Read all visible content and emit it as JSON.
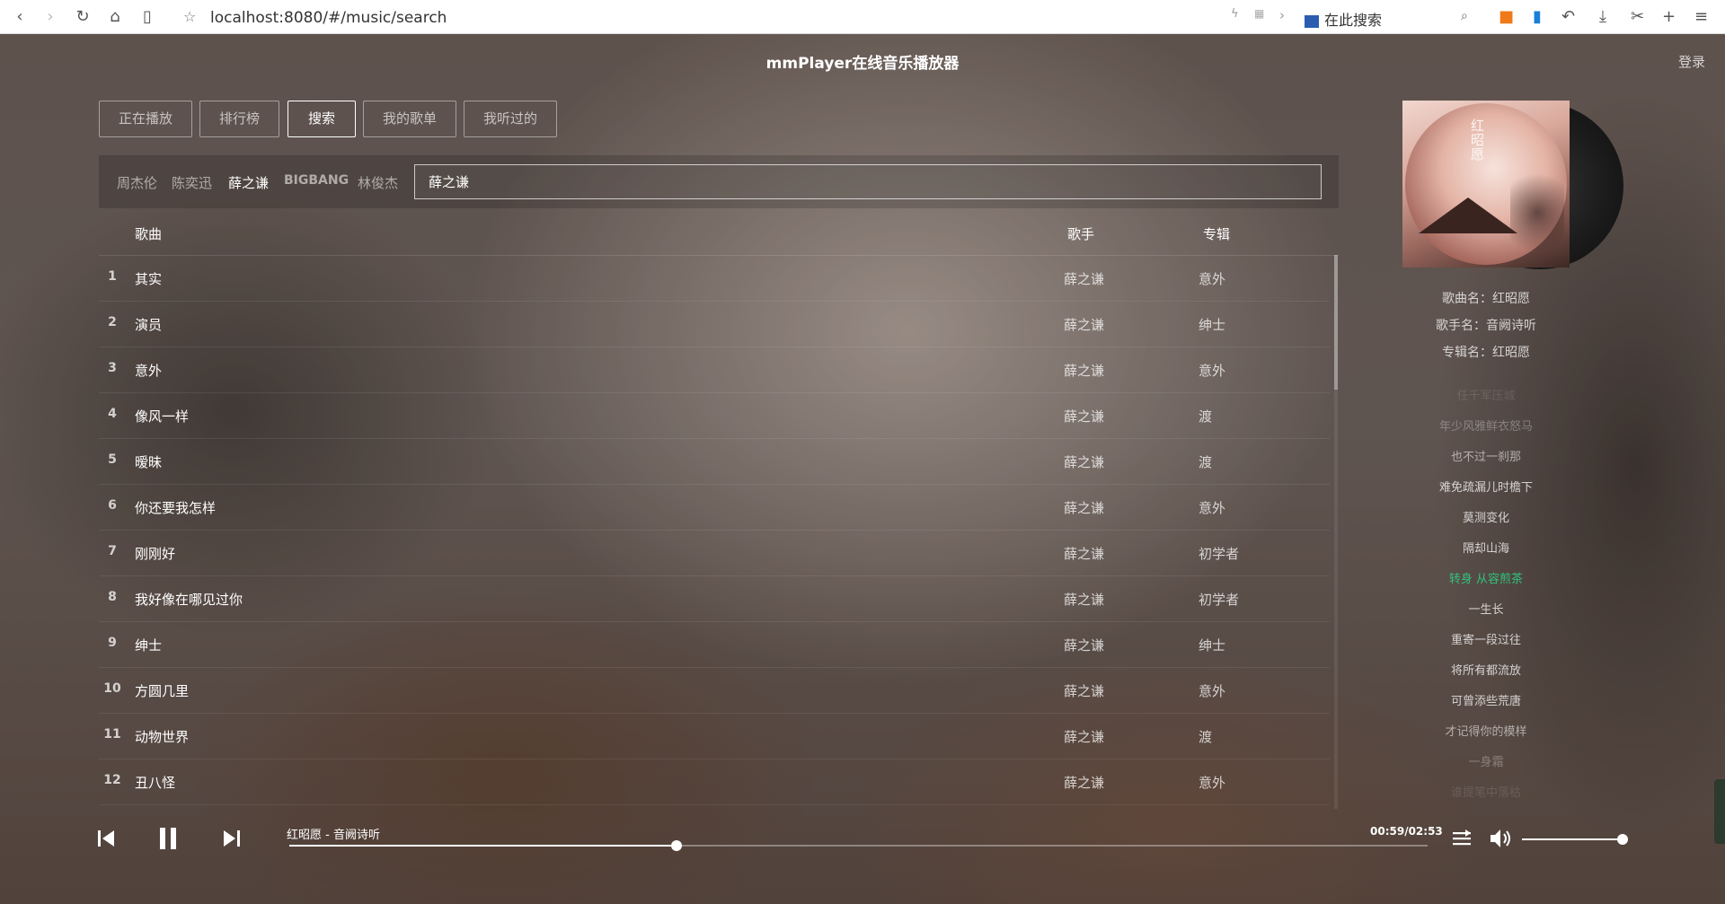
{
  "browser": {
    "url": "localhost:8080/#/music/search",
    "search_placeholder": "在此搜索"
  },
  "app": {
    "title": "mmPlayer在线音乐播放器",
    "login": "登录"
  },
  "tabs": [
    {
      "label": "正在播放"
    },
    {
      "label": "排行榜"
    },
    {
      "label": "搜索",
      "active": true
    },
    {
      "label": "我的歌单"
    },
    {
      "label": "我听过的"
    }
  ],
  "hot_singers": [
    "周杰伦",
    "陈奕迅",
    "薛之谦",
    "BIGBANG",
    "林俊杰"
  ],
  "active_singer": "薛之谦",
  "search": {
    "value": "薛之谦"
  },
  "list": {
    "headers": {
      "song": "歌曲",
      "artist": "歌手",
      "album": "专辑"
    },
    "rows": [
      {
        "num": "1",
        "name": "其实",
        "artist": "薛之谦",
        "album": "意外"
      },
      {
        "num": "2",
        "name": "演员",
        "artist": "薛之谦",
        "album": "绅士"
      },
      {
        "num": "3",
        "name": "意外",
        "artist": "薛之谦",
        "album": "意外"
      },
      {
        "num": "4",
        "name": "像风一样",
        "artist": "薛之谦",
        "album": "渡"
      },
      {
        "num": "5",
        "name": "暧昧",
        "artist": "薛之谦",
        "album": "渡"
      },
      {
        "num": "6",
        "name": "你还要我怎样",
        "artist": "薛之谦",
        "album": "意外"
      },
      {
        "num": "7",
        "name": "刚刚好",
        "artist": "薛之谦",
        "album": "初学者"
      },
      {
        "num": "8",
        "name": "我好像在哪见过你",
        "artist": "薛之谦",
        "album": "初学者"
      },
      {
        "num": "9",
        "name": "绅士",
        "artist": "薛之谦",
        "album": "绅士"
      },
      {
        "num": "10",
        "name": "方圆几里",
        "artist": "薛之谦",
        "album": "意外"
      },
      {
        "num": "11",
        "name": "动物世界",
        "artist": "薛之谦",
        "album": "渡"
      },
      {
        "num": "12",
        "name": "丑八怪",
        "artist": "薛之谦",
        "album": "意外"
      }
    ]
  },
  "now_playing": {
    "cover_glyph": "红昭愿",
    "song_line": "歌曲名：红昭愿",
    "artist_line": "歌手名：音阙诗听",
    "album_line": "专辑名：红昭愿",
    "bar_title": "红昭愿 - 音阙诗听",
    "time": "00:59/02:53",
    "progress": 0.34,
    "volume": 1.0
  },
  "lyrics": [
    {
      "text": "任千军压城",
      "opacity": 0.12
    },
    {
      "text": "年少风雅鲜衣怒马",
      "opacity": 0.3
    },
    {
      "text": "也不过一刹那",
      "opacity": 0.55
    },
    {
      "text": "难免疏漏儿时檐下",
      "opacity": 0.75
    },
    {
      "text": "莫测变化",
      "opacity": 0.75
    },
    {
      "text": "隔却山海",
      "opacity": 0.75
    },
    {
      "text": "转身 从容煎茶",
      "current": true
    },
    {
      "text": "一生长",
      "opacity": 0.75
    },
    {
      "text": "重寄一段过往",
      "opacity": 0.75
    },
    {
      "text": "将所有都流放",
      "opacity": 0.75
    },
    {
      "text": "可曾添些荒唐",
      "opacity": 0.75
    },
    {
      "text": "才记得你的模样",
      "opacity": 0.55
    },
    {
      "text": "一身霜",
      "opacity": 0.3
    },
    {
      "text": "谁提笔中落枯",
      "opacity": 0.12
    }
  ],
  "colors": {
    "accent_current_lyric": "#31c27c",
    "text_primary": "#ffffff"
  },
  "icons": {
    "prev": "skip-previous-icon",
    "pause": "pause-icon",
    "next": "skip-next-icon",
    "mode": "playlist-mode-icon",
    "volume": "volume-icon"
  }
}
